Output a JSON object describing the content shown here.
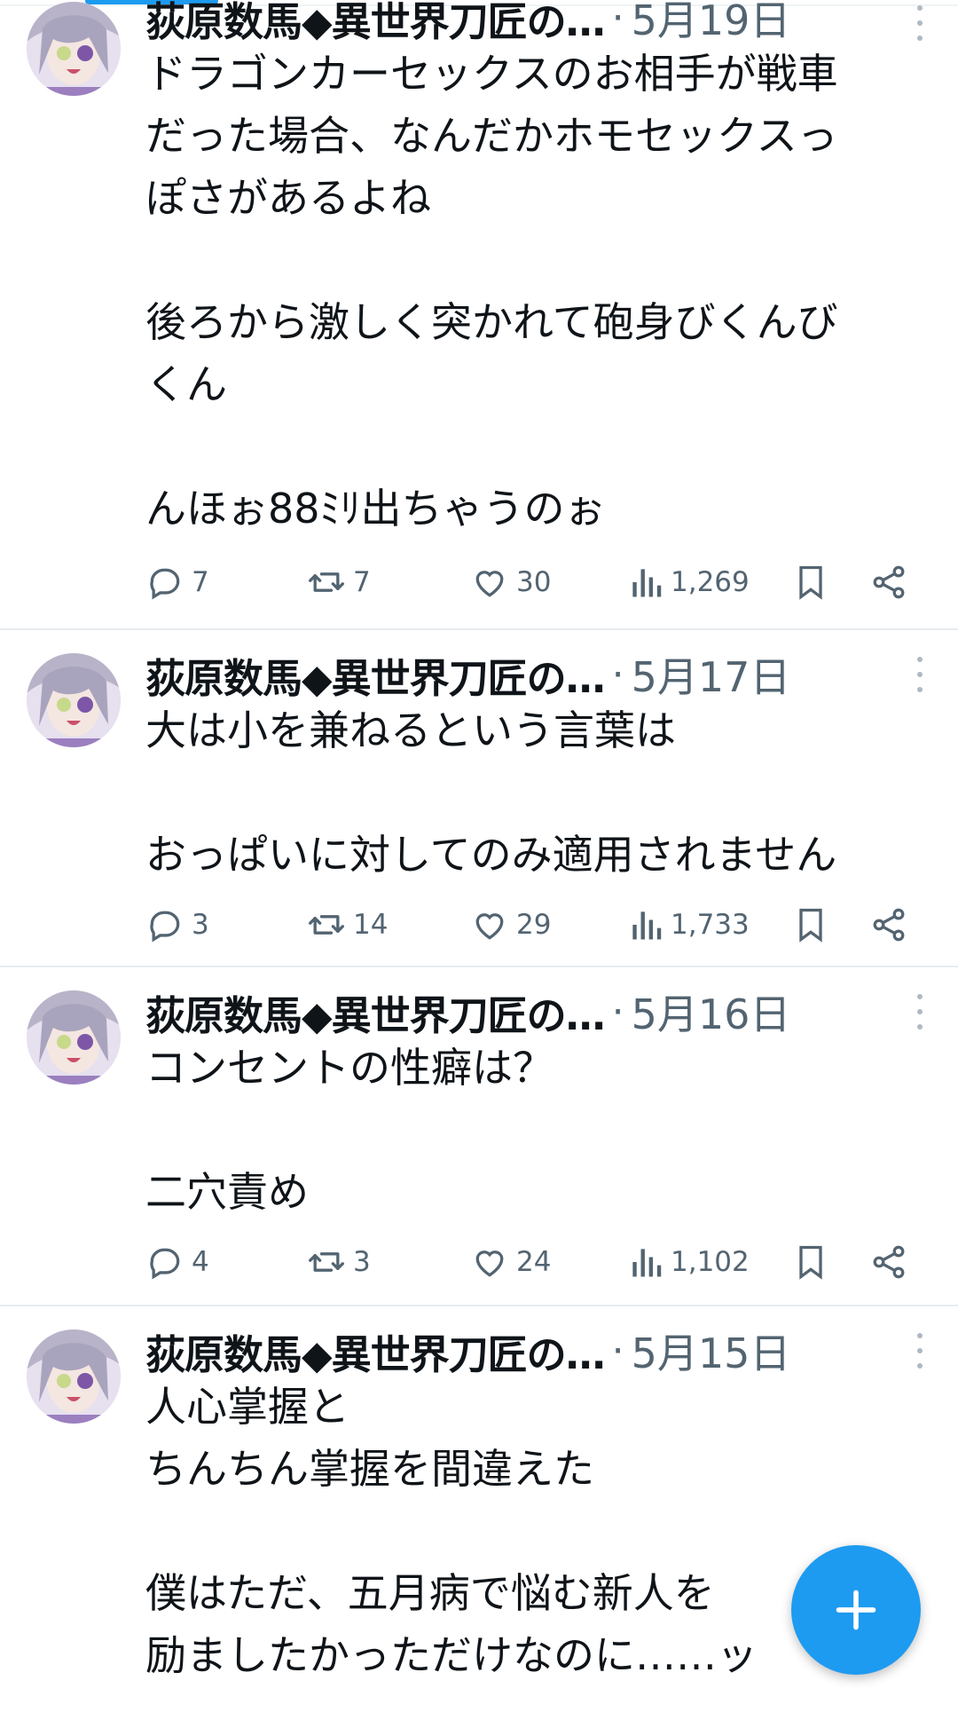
{
  "tweets": [
    {
      "author": "荻原数馬◆異世界刀匠の…",
      "date": "5月19日",
      "lines": [
        "ドラゴンカーセックスのお相手が戦車",
        "だった場合、なんだかホモセックスっ",
        "ぽさがあるよね",
        "",
        "後ろから激しく突かれて砲身びくんび",
        "くん",
        "",
        "んほぉ88ﾐﾘ出ちゃうのぉ"
      ],
      "replies": "7",
      "retweets": "7",
      "likes": "30",
      "views": "1,269"
    },
    {
      "author": "荻原数馬◆異世界刀匠の…",
      "date": "5月17日",
      "lines": [
        "大は小を兼ねるという言葉は",
        "",
        "おっぱいに対してのみ適用されません"
      ],
      "replies": "3",
      "retweets": "14",
      "likes": "29",
      "views": "1,733"
    },
    {
      "author": "荻原数馬◆異世界刀匠の…",
      "date": "5月16日",
      "lines": [
        "コンセントの性癖は？",
        "",
        "二穴責め"
      ],
      "replies": "4",
      "retweets": "3",
      "likes": "24",
      "views": "1,102"
    },
    {
      "author": "荻原数馬◆異世界刀匠の…",
      "date": "5月15日",
      "lines": [
        "人心掌握と",
        "ちんちん掌握を間違えた",
        "",
        "僕はただ、五月病で悩む新人を",
        "励ましたかっただけなのに……ッ"
      ]
    }
  ],
  "separator": "·",
  "icons": {
    "reply": "speech-bubble-icon",
    "retweet": "retweet-arrows-icon",
    "like": "heart-icon",
    "views": "bar-chart-icon",
    "bookmark": "bookmark-icon",
    "share": "share-icon",
    "more": "vertical-dots-icon",
    "compose": "plus-icon"
  },
  "colors": {
    "accent": "#1d9bf0",
    "text": "#0f1419",
    "muted": "#536471"
  }
}
